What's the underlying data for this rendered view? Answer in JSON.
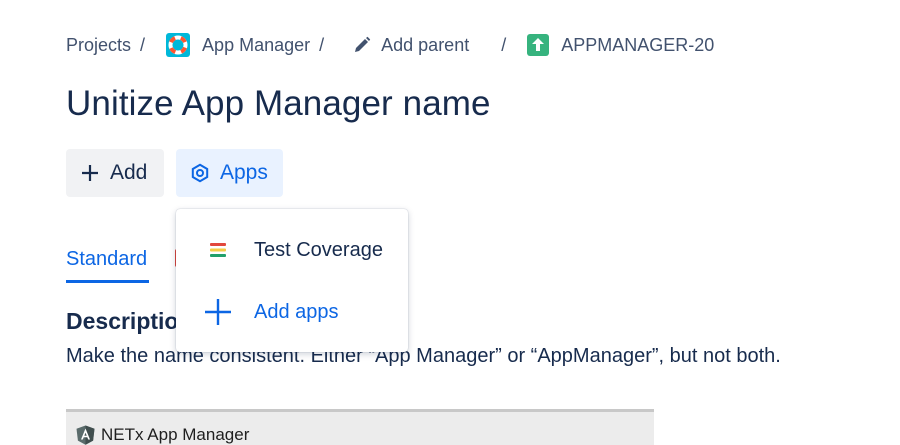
{
  "breadcrumb": {
    "projects": "Projects",
    "project": "App Manager",
    "add_parent": "Add parent",
    "issue_key": "APPMANAGER-20",
    "separator": "/"
  },
  "issue": {
    "title": "Unitize App Manager name"
  },
  "toolbar": {
    "add_label": "Add",
    "apps_label": "Apps"
  },
  "tabs": [
    {
      "label": "Standard"
    }
  ],
  "description": {
    "heading": "Description",
    "text": "Make the name consistent. Either “App Manager” or “AppManager”, but not both."
  },
  "embed": {
    "title": "NETx App Manager"
  },
  "apps_menu": {
    "items": [
      {
        "label": "Test Coverage",
        "icon": "test-coverage-icon"
      },
      {
        "label": "Add apps",
        "icon": "plus-icon"
      }
    ]
  },
  "colors": {
    "accent": "#0c66e4",
    "text": "#172b4d",
    "story": "#36b37e"
  }
}
